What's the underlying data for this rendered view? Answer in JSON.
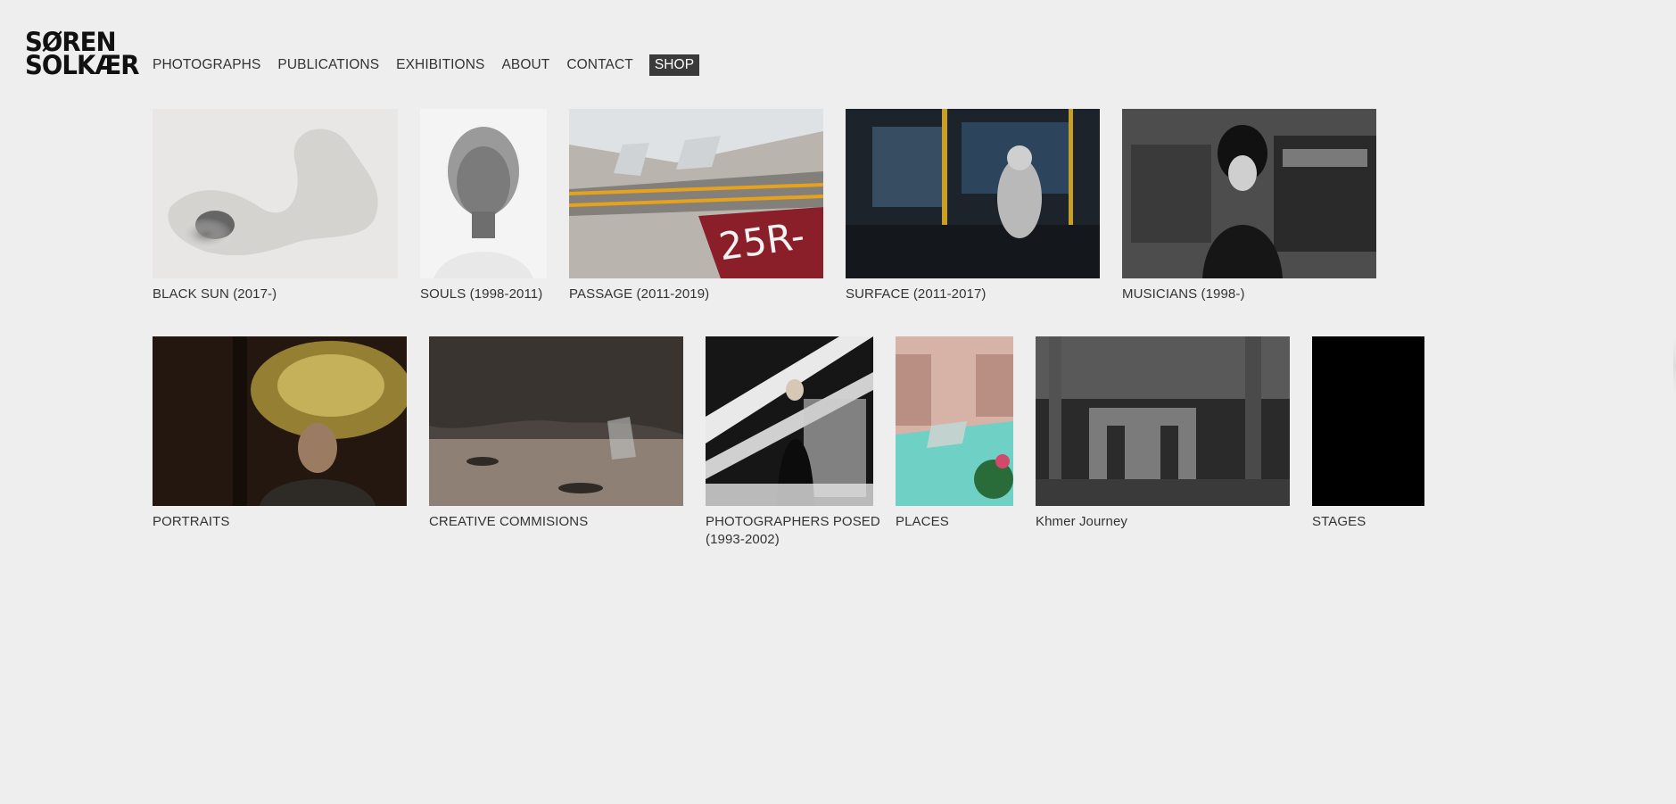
{
  "site": {
    "logo_line1": "SØREN",
    "logo_line2": "SOLKÆR"
  },
  "nav": {
    "items": [
      {
        "label": "PHOTOGRAPHS"
      },
      {
        "label": "PUBLICATIONS"
      },
      {
        "label": "EXHIBITIONS"
      },
      {
        "label": "ABOUT"
      },
      {
        "label": "CONTACT"
      },
      {
        "label": "SHOP"
      }
    ]
  },
  "galleries": [
    {
      "title": "BLACK SUN (2017-)"
    },
    {
      "title": "SOULS (1998-2011)"
    },
    {
      "title": "PASSAGE (2011-2019)"
    },
    {
      "title": "SURFACE (2011-2017)"
    },
    {
      "title": "MUSICIANS (1998-)"
    },
    {
      "title": "PORTRAITS"
    },
    {
      "title": "CREATIVE COMMISIONS"
    },
    {
      "title": "PHOTOGRAPHERS POSED",
      "title2": "(1993-2002)"
    },
    {
      "title": "PLACES"
    },
    {
      "title": "Khmer Journey"
    },
    {
      "title": "STAGES"
    }
  ],
  "thumb_text": {
    "runway_marking": "25R-"
  },
  "colors": {
    "background": "#edeeed",
    "shop_bg": "#3a3a3a",
    "text": "#2b2b2b"
  }
}
